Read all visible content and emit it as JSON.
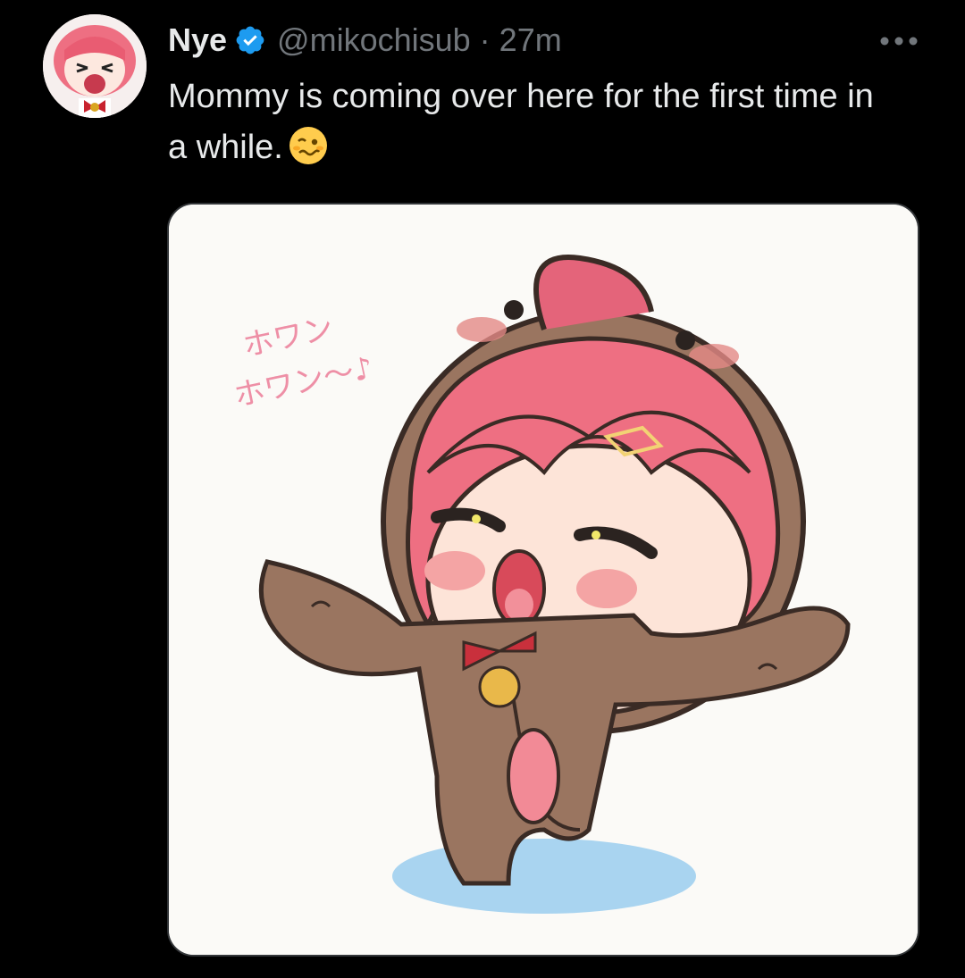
{
  "author": {
    "display_name": "Nye",
    "handle": "@mikochisub",
    "separator": "·",
    "time": "27m",
    "verified_icon": "verified-badge-icon",
    "avatar_icon": "profile-avatar"
  },
  "tweet": {
    "text": "Mommy is coming over here for the first time in a while.",
    "emoji_icon": "woozy-face-emoji",
    "more_icon": "more-options-icon"
  },
  "media": {
    "image_text_line1": "ホワン",
    "image_text_line2": "ホワン～♪"
  },
  "colors": {
    "background": "#000000",
    "text_primary": "#e7e9ea",
    "text_secondary": "#71767b",
    "verified": "#1d9bf0",
    "media_border": "#333639"
  }
}
